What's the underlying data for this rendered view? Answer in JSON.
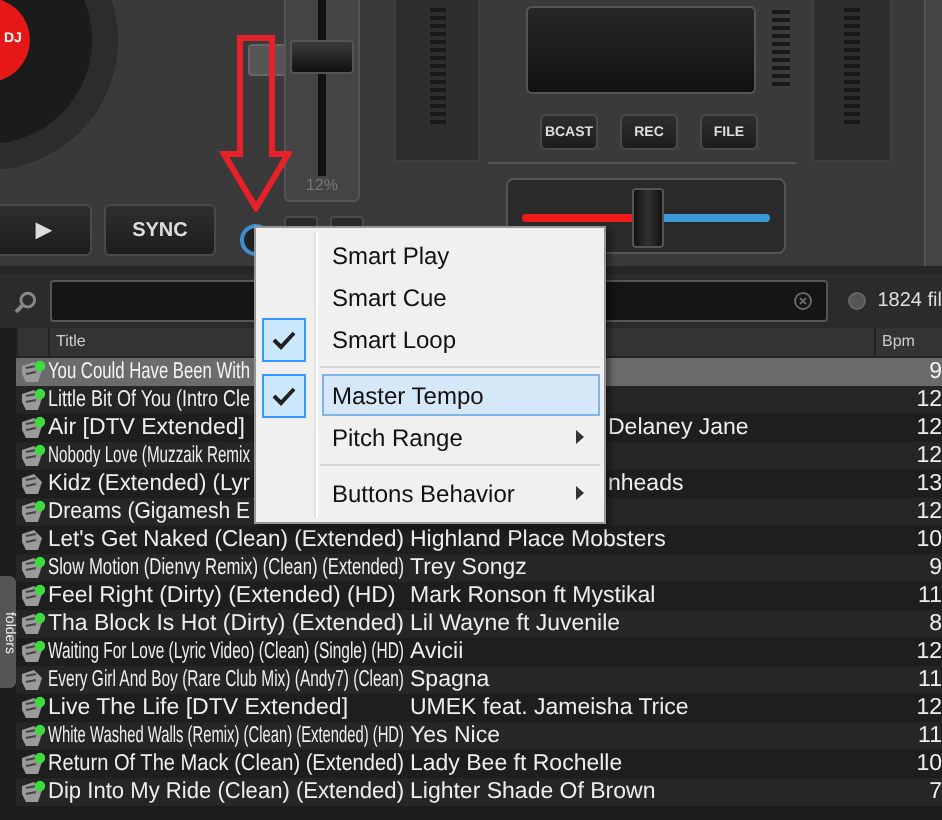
{
  "deck": {
    "logo": "DJ",
    "pitch": {
      "level": 0.72,
      "label": "12%"
    },
    "play_button": "▶",
    "sync_button": "SYNC"
  },
  "mixer": {
    "buttons": [
      "BCAST",
      "REC",
      "FILE"
    ],
    "crossfader": {
      "level": 0.51
    }
  },
  "search": {
    "option_selected": false,
    "file_count": "1824 fil"
  },
  "side_tab": "folders",
  "table": {
    "columns": [
      {
        "kind": "title",
        "label": "Title"
      },
      {
        "kind": "artist"
      },
      {
        "kind": "bpm",
        "label": "Bpm"
      }
    ],
    "rows": [
      {
        "title": "You Could Have Been With",
        "bpm": "9",
        "tagged": true,
        "selected": true
      },
      {
        "title": "Little Bit Of You (Intro Cle",
        "bpm": "12",
        "tagged": true,
        "selected": false
      },
      {
        "title": "Air [DTV Extended]",
        "artist": "Delaney Jane",
        "bpm": "12",
        "tagged": true,
        "selected": false
      },
      {
        "title": "Nobody Love (Muzzaik Remix",
        "bpm": "12",
        "tagged": true,
        "selected": false
      },
      {
        "title": "Kidz (Extended) (Lyr",
        "artist": "nheads",
        "bpm": "13",
        "tagged": false,
        "selected": false
      },
      {
        "title": "Dreams (Gigamesh E",
        "bpm": "12",
        "tagged": true,
        "selected": false
      },
      {
        "title": "Let's Get Naked (Clean) (Extended)",
        "artist": "Highland Place Mobsters",
        "bpm": "10",
        "tagged": false,
        "selected": false
      },
      {
        "title": "Slow Motion (Dienvy Remix) (Clean) (Extended)",
        "artist": "Trey Songz",
        "bpm": "9",
        "tagged": true,
        "selected": false
      },
      {
        "title": "Feel Right (Dirty) (Extended) (HD)",
        "artist": "Mark Ronson ft Mystikal",
        "bpm": "11",
        "tagged": true,
        "selected": false
      },
      {
        "title": "Tha Block Is Hot (Dirty) (Extended)",
        "artist": "Lil Wayne ft Juvenile",
        "bpm": "8",
        "tagged": true,
        "selected": false
      },
      {
        "title": "Waiting For Love (Lyric Video) (Clean) (Single) (HD)",
        "artist": "Avicii",
        "bpm": "12",
        "tagged": true,
        "selected": false
      },
      {
        "title": "Every Girl And Boy (Rare Club Mix) (Andy7) (Clean)",
        "artist": "Spagna",
        "bpm": "11",
        "tagged": false,
        "selected": false
      },
      {
        "title": "Live The Life [DTV Extended]",
        "artist": "UMEK feat. Jameisha Trice",
        "bpm": "12",
        "tagged": true,
        "selected": false
      },
      {
        "title": "White Washed Walls (Remix) (Clean) (Extended) (HD)",
        "artist": "Yes Nice",
        "bpm": "11",
        "tagged": true,
        "selected": false
      },
      {
        "title": "Return Of The Mack (Clean) (Extended)",
        "artist": "Lady Bee ft Rochelle",
        "bpm": "10",
        "tagged": true,
        "selected": false
      },
      {
        "title": "Dip Into My Ride (Clean) (Extended)",
        "artist": "Lighter Shade Of Brown",
        "bpm": "7",
        "tagged": true,
        "selected": false
      }
    ]
  },
  "context_menu": {
    "items": [
      {
        "kind": "item",
        "label": "Smart Play",
        "checked": false,
        "selected": false,
        "submenu": false
      },
      {
        "kind": "item",
        "label": "Smart Cue",
        "checked": false,
        "selected": false,
        "submenu": false
      },
      {
        "kind": "item",
        "label": "Smart Loop",
        "checked": true,
        "selected": false,
        "submenu": false
      },
      {
        "kind": "separator"
      },
      {
        "kind": "item",
        "label": "Master Tempo",
        "checked": true,
        "selected": true,
        "submenu": false
      },
      {
        "kind": "item",
        "label": "Pitch Range",
        "checked": false,
        "selected": false,
        "submenu": true
      },
      {
        "kind": "separator"
      },
      {
        "kind": "item",
        "label": "Buttons Behavior",
        "checked": false,
        "selected": false,
        "submenu": true
      }
    ]
  }
}
